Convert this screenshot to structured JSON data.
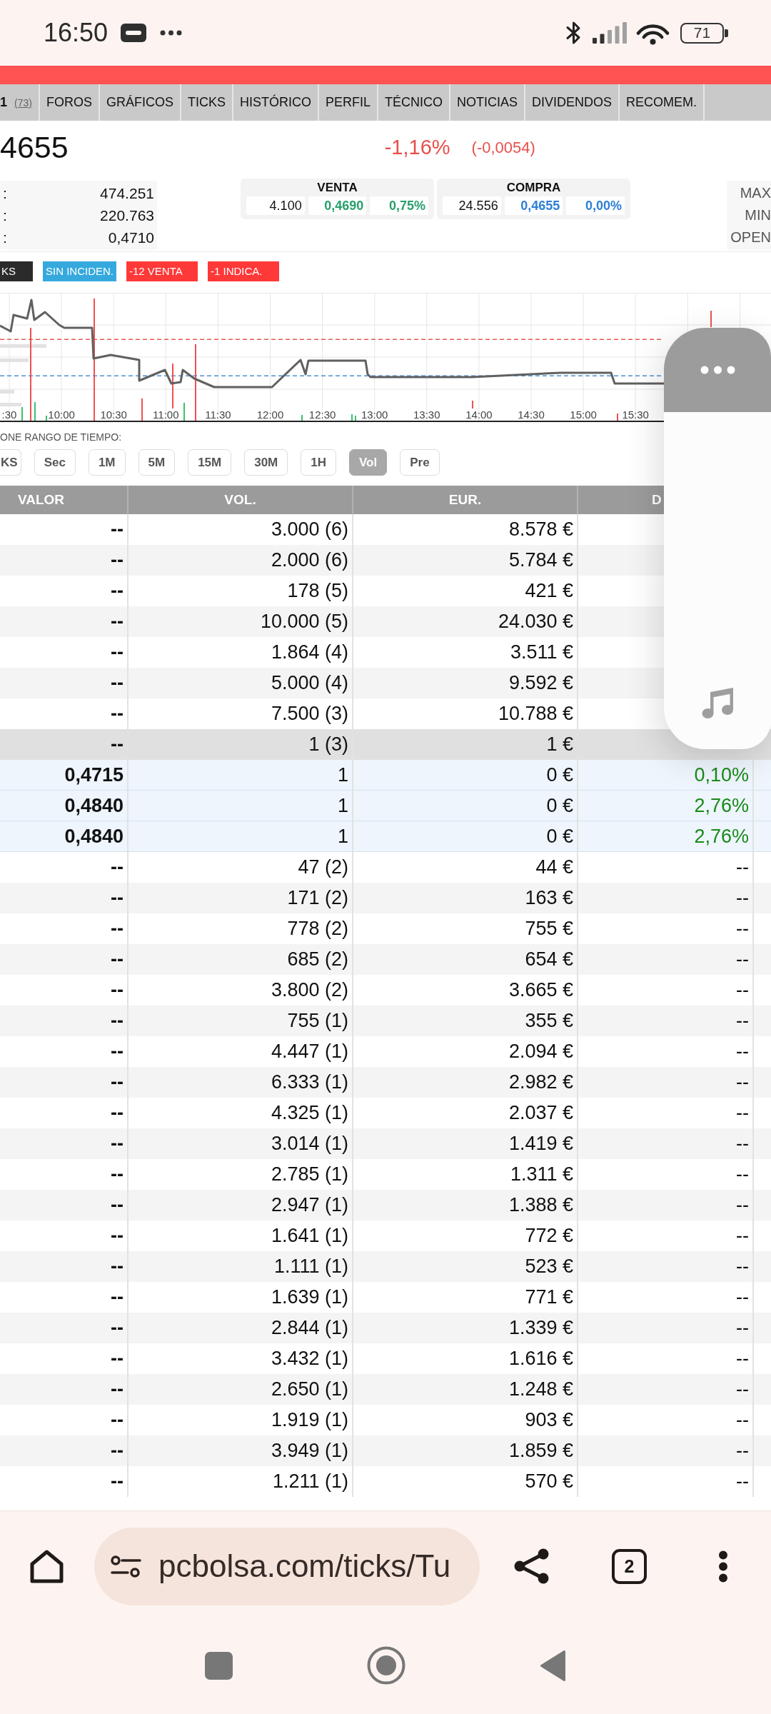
{
  "status_bar": {
    "time": "16:50",
    "battery": "71"
  },
  "tabs": [
    {
      "label": "1",
      "count": "(73)"
    },
    {
      "label": "FOROS"
    },
    {
      "label": "GRÁFICOS"
    },
    {
      "label": "TICKS"
    },
    {
      "label": "HISTÓRICO"
    },
    {
      "label": "PERFIL"
    },
    {
      "label": "TÉCNICO"
    },
    {
      "label": "NOTICIAS"
    },
    {
      "label": "DIVIDENDOS"
    },
    {
      "label": "RECOMEM."
    }
  ],
  "quote": {
    "price": "4655",
    "change_percent": "-1,16%",
    "change": "(-0,0054)"
  },
  "stats": [
    {
      "label": ":",
      "value": "474.251"
    },
    {
      "label": ":",
      "value": "220.763"
    },
    {
      "label": ":",
      "value": "0,4710"
    }
  ],
  "order_book": [
    {
      "kind": "sell",
      "title": "VENTA",
      "quantity": "4.100",
      "price": "0,4690",
      "change": "0,75%"
    },
    {
      "kind": "buy",
      "title": "COMPRA",
      "quantity": "24.556",
      "price": "0,4655",
      "change": "0,00%"
    }
  ],
  "range_stats": [
    "MAX",
    "MIN",
    "OPEN"
  ],
  "badges": [
    {
      "label": "KS",
      "color": "#2b2b2b"
    },
    {
      "label": "SIN INCIDEN.",
      "color": "#35a9dd"
    },
    {
      "label": "-12 VENTA",
      "color": "#ff3838"
    },
    {
      "label": "-1 INDICA.",
      "color": "#ff3838"
    }
  ],
  "chart": {
    "time_labels": [
      ":30",
      "10:00",
      "10:30",
      "11:00",
      "11:30",
      "12:00",
      "12:30",
      "13:00",
      "13:30",
      "14:00",
      "14:30",
      "15:00",
      "15:30"
    ]
  },
  "time_range": {
    "label": "ONE RANGO DE TIEMPO:",
    "buttons": [
      {
        "label": "KS",
        "selected": false
      },
      {
        "label": "Sec",
        "selected": false
      },
      {
        "label": "1M",
        "selected": false
      },
      {
        "label": "5M",
        "selected": false
      },
      {
        "label": "15M",
        "selected": false
      },
      {
        "label": "30M",
        "selected": false
      },
      {
        "label": "1H",
        "selected": false
      },
      {
        "label": "Vol",
        "selected": true
      },
      {
        "label": "Pre",
        "selected": false
      }
    ]
  },
  "table": {
    "columns": [
      "VALOR",
      "VOL.",
      "EUR.",
      "D"
    ],
    "rows": [
      {
        "kind": "light",
        "cells": [
          "--",
          "3.000 (6)",
          "8.578 €"
        ]
      },
      {
        "kind": "shaded",
        "cells": [
          "--",
          "2.000 (6)",
          "5.784 €"
        ]
      },
      {
        "kind": "light",
        "cells": [
          "--",
          "178 (5)",
          "421 €"
        ]
      },
      {
        "kind": "shaded",
        "cells": [
          "--",
          "10.000 (5)",
          "24.030 €"
        ]
      },
      {
        "kind": "light",
        "cells": [
          "--",
          "1.864 (4)",
          "3.511 €"
        ]
      },
      {
        "kind": "shaded",
        "cells": [
          "--",
          "5.000 (4)",
          "9.592 €"
        ]
      },
      {
        "kind": "light",
        "cells": [
          "--",
          "7.500 (3)",
          "10.788 €"
        ]
      },
      {
        "kind": "total",
        "cells": [
          "--",
          "1 (3)",
          "1 €"
        ]
      },
      {
        "kind": "trade",
        "cells": [
          "0,4715",
          "1",
          "0 €",
          "0,10%"
        ]
      },
      {
        "kind": "trade",
        "cells": [
          "0,4840",
          "1",
          "0 €",
          "2,76%"
        ]
      },
      {
        "kind": "trade",
        "cells": [
          "0,4840",
          "1",
          "0 €",
          "2,76%"
        ]
      },
      {
        "kind": "light",
        "cells": [
          "--",
          "47 (2)",
          "44 €",
          "--"
        ]
      },
      {
        "kind": "shaded",
        "cells": [
          "--",
          "171 (2)",
          "163 €",
          "--"
        ]
      },
      {
        "kind": "light",
        "cells": [
          "--",
          "778 (2)",
          "755 €",
          "--"
        ]
      },
      {
        "kind": "shaded",
        "cells": [
          "--",
          "685 (2)",
          "654 €",
          "--"
        ]
      },
      {
        "kind": "light",
        "cells": [
          "--",
          "3.800 (2)",
          "3.665 €",
          "--"
        ]
      },
      {
        "kind": "shaded",
        "cells": [
          "--",
          "755 (1)",
          "355 €",
          "--"
        ]
      },
      {
        "kind": "light",
        "cells": [
          "--",
          "4.447 (1)",
          "2.094 €",
          "--"
        ]
      },
      {
        "kind": "shaded",
        "cells": [
          "--",
          "6.333 (1)",
          "2.982 €",
          "--"
        ]
      },
      {
        "kind": "light",
        "cells": [
          "--",
          "4.325 (1)",
          "2.037 €",
          "--"
        ]
      },
      {
        "kind": "shaded",
        "cells": [
          "--",
          "3.014 (1)",
          "1.419 €",
          "--"
        ]
      },
      {
        "kind": "light",
        "cells": [
          "--",
          "2.785 (1)",
          "1.311 €",
          "--"
        ]
      },
      {
        "kind": "shaded",
        "cells": [
          "--",
          "2.947 (1)",
          "1.388 €",
          "--"
        ]
      },
      {
        "kind": "light",
        "cells": [
          "--",
          "1.641 (1)",
          "772 €",
          "--"
        ]
      },
      {
        "kind": "shaded",
        "cells": [
          "--",
          "1.111 (1)",
          "523 €",
          "--"
        ]
      },
      {
        "kind": "light",
        "cells": [
          "--",
          "1.639 (1)",
          "771 €",
          "--"
        ]
      },
      {
        "kind": "shaded",
        "cells": [
          "--",
          "2.844 (1)",
          "1.339 €",
          "--"
        ]
      },
      {
        "kind": "light",
        "cells": [
          "--",
          "3.432 (1)",
          "1.616 €",
          "--"
        ]
      },
      {
        "kind": "shaded",
        "cells": [
          "--",
          "2.650 (1)",
          "1.248 €",
          "--"
        ]
      },
      {
        "kind": "light",
        "cells": [
          "--",
          "1.919 (1)",
          "903 €",
          "--"
        ]
      },
      {
        "kind": "shaded",
        "cells": [
          "--",
          "3.949 (1)",
          "1.859 €",
          "--"
        ]
      },
      {
        "kind": "light",
        "cells": [
          "--",
          "1.211 (1)",
          "570 €",
          "--"
        ]
      }
    ]
  },
  "browser": {
    "url": "pcbolsa.com/ticks/Tu",
    "tab_count": "2"
  }
}
